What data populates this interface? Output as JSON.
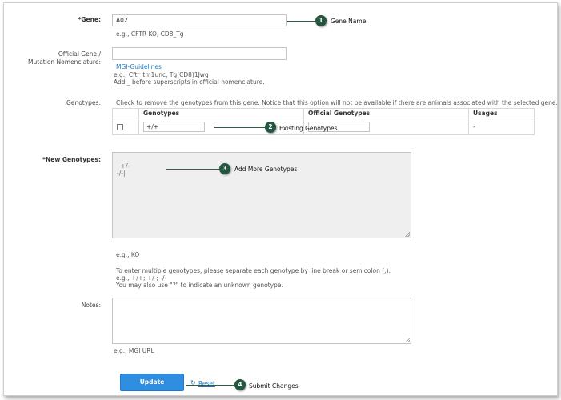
{
  "form": {
    "gene": {
      "label": "*Gene:",
      "value": "A02",
      "hint": "e.g., CFTR KO, CD8_Tg"
    },
    "official_gene": {
      "label_line1": "Official Gene /",
      "label_line2": "Mutation Nomenclature:",
      "value": "",
      "link": "MGI-Guidelines",
      "hint1": "e.g., Cftr_tm1unc, Tg(CD8)1Jwg",
      "hint2": "Add _ before superscripts in official nomenclature."
    },
    "genotypes": {
      "label": "Genotypes:",
      "notice": "Check to remove the genotypes from this gene. Notice that this option will not be available if there are animals associated with the selected gene.",
      "columns": [
        "Genotypes",
        "Official Genotypes",
        "Usages"
      ],
      "rows": [
        {
          "genotype": "+/+",
          "official": "",
          "usages": "-"
        }
      ]
    },
    "new_genotypes": {
      "label": "*New Genotypes:",
      "value": "+/-\n-/-|",
      "hint1": "e.g., KO",
      "hint2": "To enter multiple genotypes, please separate each genotype by line break or semicolon (;).",
      "hint3": "e.g., +/+; +/-; -/-",
      "hint4": "You may also use \"?\" to indicate an unknown genotype."
    },
    "notes": {
      "label": "Notes:",
      "value": "",
      "hint": "e.g., MGI URL"
    },
    "actions": {
      "update": "Update",
      "reset": "Reset"
    }
  },
  "callouts": [
    {
      "number": "1",
      "text": "Gene Name"
    },
    {
      "number": "2",
      "text": "Existing Genotypes"
    },
    {
      "number": "3",
      "text": "Add More Genotypes"
    },
    {
      "number": "4",
      "text": "Submit Changes"
    }
  ],
  "colors": {
    "callout_badge": "#24573f",
    "primary_button": "#2f8ee0",
    "link": "#1f7bc1"
  }
}
